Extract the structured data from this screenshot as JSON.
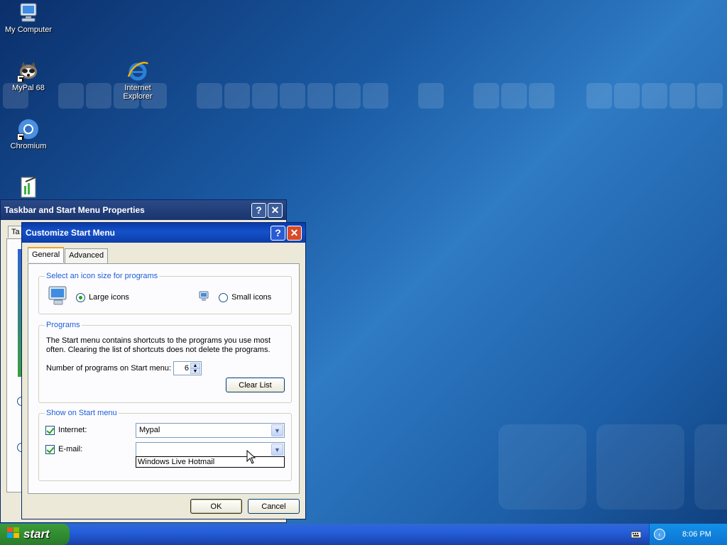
{
  "desktop": {
    "icons": [
      {
        "label": "My Computer"
      },
      {
        "label": "MyPal 68"
      },
      {
        "label": "Internet Explorer"
      },
      {
        "label": "Chromium"
      }
    ]
  },
  "taskbar_props": {
    "title": "Taskbar and Start Menu Properties",
    "help": "?",
    "close": "✕",
    "tab_partial": "Ta"
  },
  "customize": {
    "title": "Customize Start Menu",
    "help": "?",
    "close": "✕",
    "tabs": [
      {
        "label": "General"
      },
      {
        "label": "Advanced"
      }
    ],
    "icon_size": {
      "legend": "Select an icon size for programs",
      "large": "Large icons",
      "small": "Small icons",
      "selected": "Large icons"
    },
    "programs": {
      "legend": "Programs",
      "description": "The Start menu contains shortcuts to the programs you use most often. Clearing the list of shortcuts does not delete the programs.",
      "count_label": "Number of programs on Start menu:",
      "count_value": "6",
      "clear_button": "Clear List"
    },
    "show": {
      "legend": "Show on Start menu",
      "internet_label": "Internet:",
      "internet_checked": true,
      "internet_value": "Mypal",
      "email_label": "E-mail:",
      "email_checked": true,
      "email_value": "",
      "email_dropdown_option": "Windows Live Hotmail"
    },
    "ok": "OK",
    "cancel": "Cancel"
  },
  "taskbar": {
    "start_label": "start",
    "clock": "8:06 PM"
  }
}
